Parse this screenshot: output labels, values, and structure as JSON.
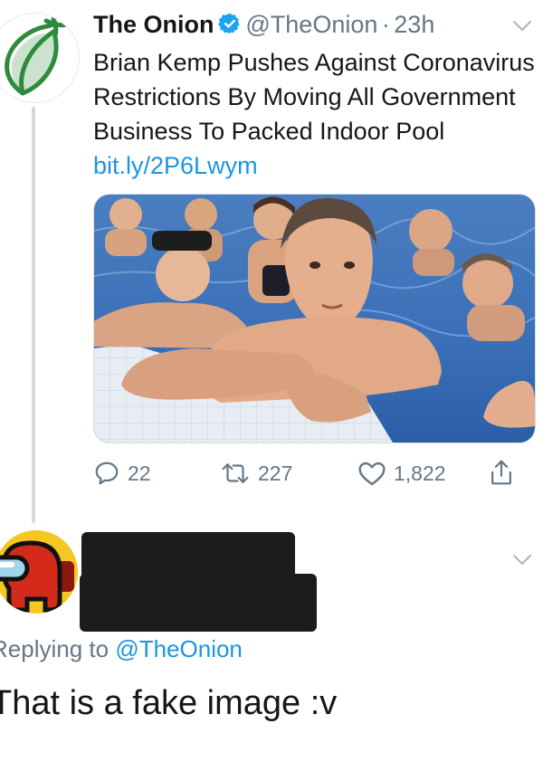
{
  "tweet": {
    "author_name": "The Onion",
    "handle": "@TheOnion",
    "separator": "·",
    "time": "23h",
    "text": "Brian Kemp Pushes Against Coronavirus Restrictions By Moving All Government Business To Packed Indoor Pool",
    "link": "bit.ly/2P6Lwym",
    "actions": {
      "replies": "22",
      "retweets": "227",
      "likes": "1,822"
    }
  },
  "reply": {
    "replying_to_prefix": "Replying to",
    "replying_to_handle": "@TheOnion",
    "text": "That is a fake image :v"
  },
  "colors": {
    "link": "#1b95e0",
    "muted": "#657786",
    "verified": "#1da1f2",
    "onion_green": "#2e8b3d",
    "among_red": "#d32a1c"
  },
  "icons": [
    "onion-logo-icon",
    "verified-badge-icon",
    "chevron-down-icon",
    "reply-icon",
    "retweet-icon",
    "like-icon",
    "share-icon",
    "among-us-crewmate-icon"
  ]
}
